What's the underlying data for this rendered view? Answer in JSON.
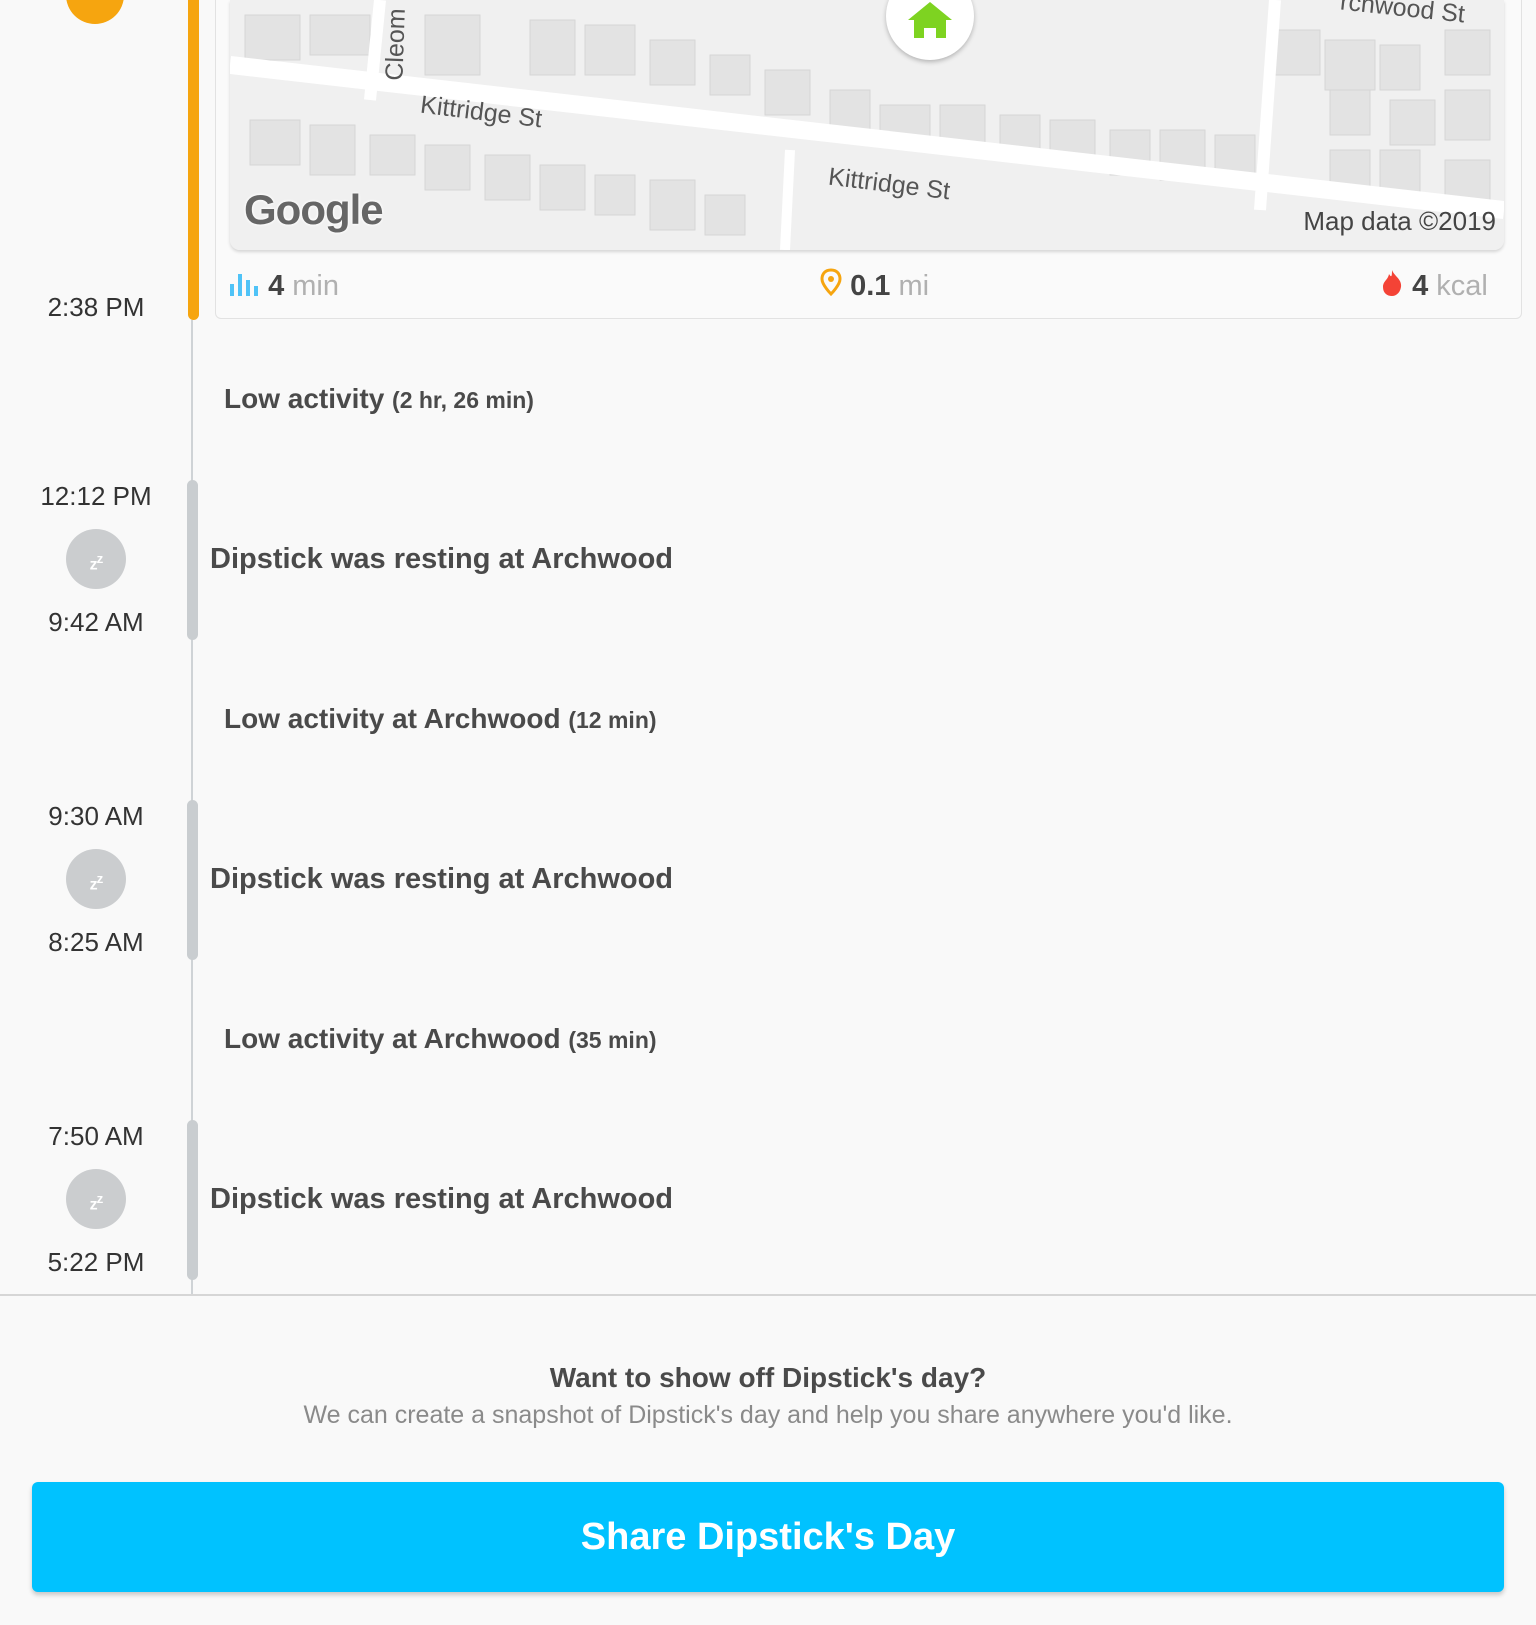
{
  "colors": {
    "walk": "#f6a50f",
    "share_button": "#00c2ff",
    "home_pin": "#7ed321",
    "distance_icon": "#f6a50f",
    "calories_icon": "#f44336",
    "duration_icon": "#4fc3f7"
  },
  "walk": {
    "end_time": "2:38 PM",
    "map": {
      "streets": [
        "Kittridge St",
        "Kittridge St",
        "Cleom",
        "rchwood St"
      ],
      "provider": "Google",
      "attribution": "Map data ©2019",
      "pin_icon": "home-icon"
    },
    "stats": {
      "duration": {
        "value": "4",
        "unit": "min",
        "icon": "bar-chart-icon"
      },
      "distance": {
        "value": "0.1",
        "unit": "mi",
        "icon": "location-pin-icon"
      },
      "calories": {
        "value": "4",
        "unit": "kcal",
        "icon": "flame-icon"
      }
    }
  },
  "timeline": {
    "low1": {
      "label": "Low activity",
      "duration": "(2 hr, 26 min)"
    },
    "rest1": {
      "start": "12:12 PM",
      "end": "9:42 AM",
      "label": "Dipstick was resting at Archwood",
      "icon": "sleep-icon"
    },
    "low2": {
      "label": "Low activity at Archwood",
      "duration": "(12 min)"
    },
    "rest2": {
      "start": "9:30 AM",
      "end": "8:25 AM",
      "label": "Dipstick was resting at Archwood",
      "icon": "sleep-icon"
    },
    "low3": {
      "label": "Low activity at Archwood",
      "duration": "(35 min)"
    },
    "rest3": {
      "start": "7:50 AM",
      "end": "5:22 PM",
      "label": "Dipstick was resting at Archwood",
      "icon": "sleep-icon"
    }
  },
  "share": {
    "title": "Want to show off Dipstick's day?",
    "subtitle": "We can create a snapshot of Dipstick's day and help you share anywhere you'd like.",
    "button": "Share Dipstick's Day"
  }
}
